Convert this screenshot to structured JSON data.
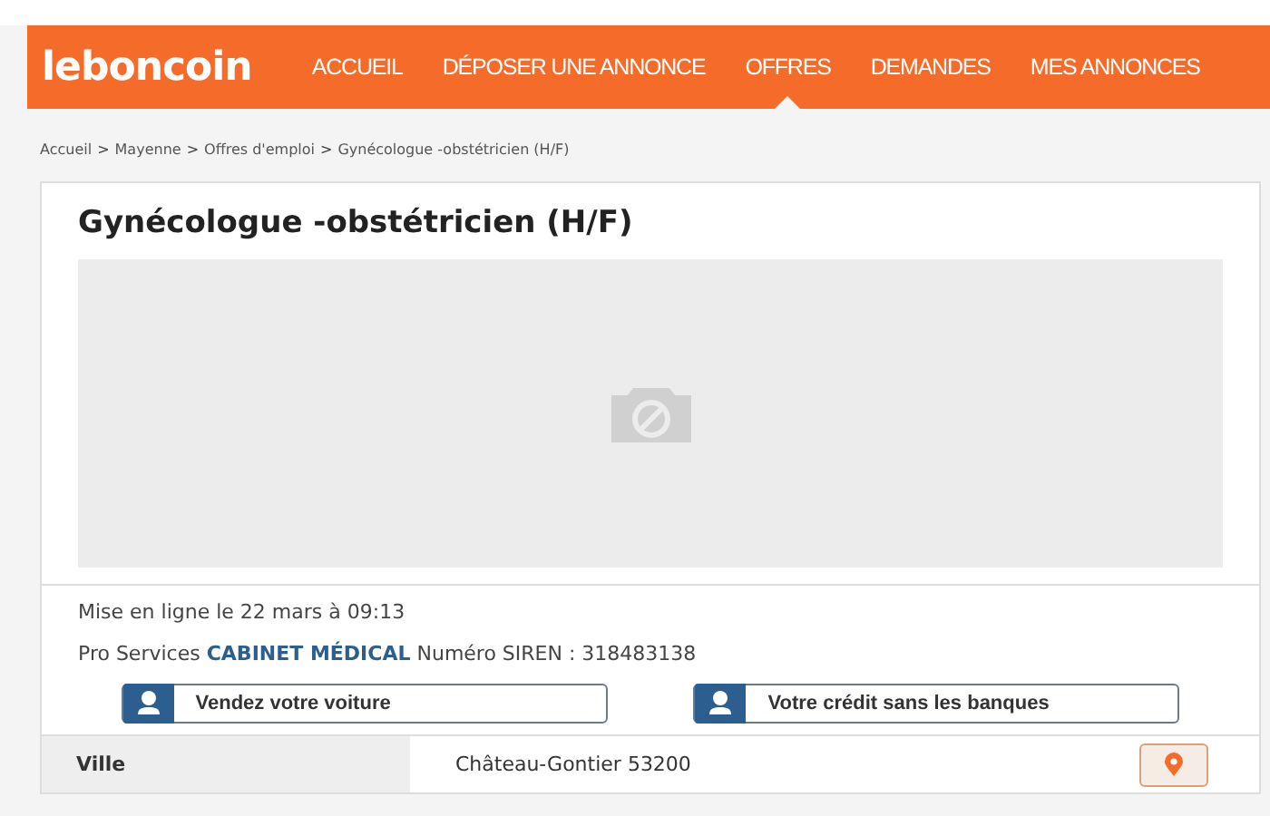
{
  "header": {
    "logo": "leboncoin",
    "nav": [
      {
        "label": "ACCUEIL",
        "selected": false
      },
      {
        "label": "DÉPOSER UNE ANNONCE",
        "selected": false
      },
      {
        "label": "OFFRES",
        "selected": true
      },
      {
        "label": "DEMANDES",
        "selected": false
      },
      {
        "label": "MES ANNONCES",
        "selected": false
      }
    ]
  },
  "breadcrumb": [
    "Accueil",
    "Mayenne",
    "Offres d'emploi",
    "Gynécologue -obstétricien (H/F)"
  ],
  "breadcrumb_separator": ">",
  "ad": {
    "title": "Gynécologue -obstétricien (H/F)",
    "posted": "Mise en ligne le 22 mars à 09:13",
    "seller": "Pro Services **CABINET MÉDICAL** Numéro SIREN : 318483138",
    "promos": [
      "Vendez votre voiture",
      "Votre crédit sans les banques"
    ],
    "details": [
      {
        "label": "Ville",
        "value": "Château-Gontier 53200"
      }
    ]
  }
}
